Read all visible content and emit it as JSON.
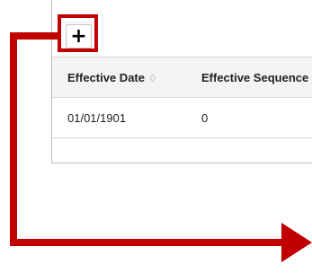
{
  "toolbar": {
    "add_icon": "plus-icon",
    "add_glyph": "+"
  },
  "grid": {
    "columns": [
      {
        "label": "Effective Date",
        "sort_icon": "sort-icon",
        "sort_glyph": "♢"
      },
      {
        "label": "Effective Sequence"
      }
    ],
    "rows": [
      {
        "effective_date": "01/01/1901",
        "effective_sequence": "0"
      }
    ]
  },
  "annotation": {
    "color": "#c00000"
  }
}
